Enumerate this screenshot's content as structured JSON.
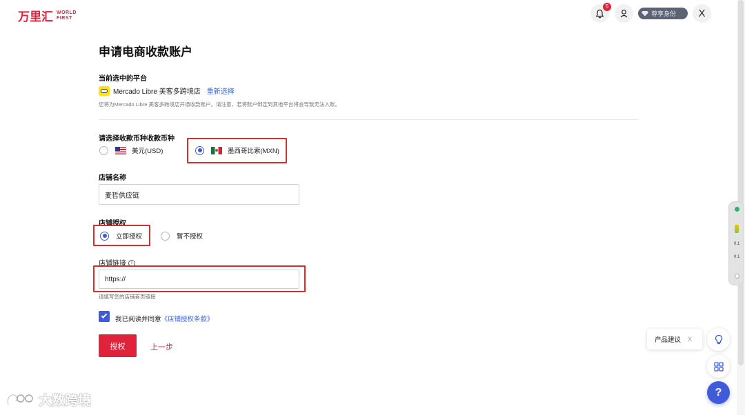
{
  "header": {
    "logo_cn": "万里汇",
    "logo_en_line1": "WORLD",
    "logo_en_line2": "FIRST",
    "notification_count": "5",
    "vip_label": "尊享身份",
    "close_symbol": "X"
  },
  "form": {
    "title": "申请电商收款账户",
    "platform_section_label": "当前选中的平台",
    "platform_name": "Mercado Libre 美客多跨境店",
    "reselect_label": "重新选择",
    "platform_note": "您将为Mercado Libre 美客多跨境店开通收款账户。请注意，若将账户绑定到其他平台将会导致无法入账。",
    "currency_section_label": "请选择收款币种收款币种",
    "currency_options": [
      {
        "label": "美元(USD)",
        "selected": false,
        "flag": "us-flag-icon"
      },
      {
        "label": "墨西哥比索(MXN)",
        "selected": true,
        "flag": "mx-flag-icon"
      }
    ],
    "store_name_label": "店铺名称",
    "store_name_value": "麦哲供应链",
    "auth_label": "店铺授权",
    "auth_options": [
      {
        "label": "立即授权",
        "selected": true
      },
      {
        "label": "暂不授权",
        "selected": false
      }
    ],
    "store_link_label": "店铺链接",
    "store_link_value": "https://",
    "store_link_hint": "请填写您的店铺首页链接",
    "agree_checked": true,
    "agree_text": "我已阅读并同意",
    "agree_link": "《店铺授权条款》",
    "submit_label": "授权",
    "back_label": "上一步"
  },
  "floating": {
    "suggest_label": "产品建议",
    "suggest_close": "X",
    "help_symbol": "?",
    "dock_labels": [
      "0.1",
      "0.1"
    ]
  },
  "watermark": {
    "text": "大数跨境"
  },
  "colors": {
    "brand_red": "#e0223b",
    "accent_blue": "#3f5bd9",
    "highlight_red": "#d82d2d"
  }
}
